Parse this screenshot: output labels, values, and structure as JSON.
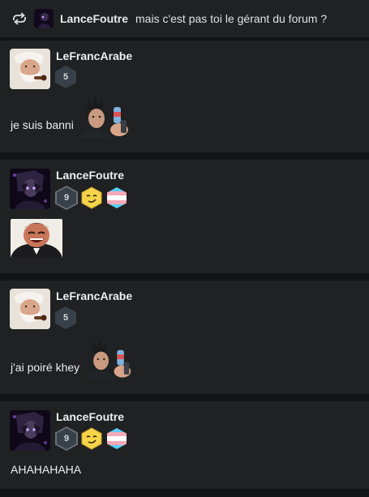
{
  "reply": {
    "author": "LanceFoutre",
    "text": "mais c'est pas toi le gérant du forum ?"
  },
  "posts": [
    {
      "author": "LeFrancArabe",
      "level": "5",
      "message": "je suis banni"
    },
    {
      "author": "LanceFoutre",
      "level": "9",
      "message": ""
    },
    {
      "author": "LeFrancArabe",
      "level": "5",
      "message": "j'ai poiré khey"
    },
    {
      "author": "LanceFoutre",
      "level": "9",
      "message": "AHAHAHAHA"
    }
  ],
  "colors": {
    "background": "#121416",
    "card": "#1f2123",
    "level_badge": "#384049",
    "smiley": "#f5d44a",
    "trans_pink": "#f5a9b8",
    "trans_blue": "#5bcefa"
  },
  "icons": [
    "reply-arrow-icon",
    "smiley-icon",
    "trans-flag-icon",
    "sticker-image"
  ]
}
